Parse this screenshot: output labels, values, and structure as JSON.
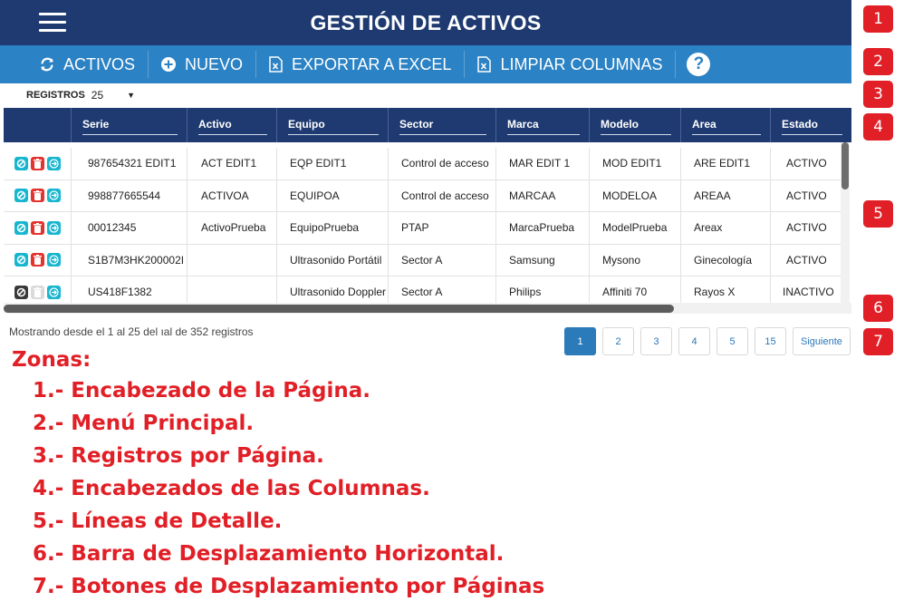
{
  "header": {
    "title": "GESTIÓN DE ACTIVOS"
  },
  "menu": {
    "items": [
      {
        "label": "ACTIVOS",
        "icon": "refresh-icon"
      },
      {
        "label": "NUEVO",
        "icon": "plus-circle-icon"
      },
      {
        "label": "EXPORTAR A EXCEL",
        "icon": "excel-icon"
      },
      {
        "label": "LIMPIAR COLUMNAS",
        "icon": "excel-icon"
      }
    ],
    "help": "?"
  },
  "registros": {
    "label": "REGISTROS",
    "value": "25"
  },
  "table": {
    "columns": [
      "Serie",
      "Activo",
      "Equipo",
      "Sector",
      "Marca",
      "Modelo",
      "Area",
      "Estado"
    ],
    "rows": [
      {
        "serie": "987654321 EDIT1",
        "activo": "ACT EDIT1",
        "equipo": "EQP EDIT1",
        "sector": "Control de acceso",
        "marca": "MAR EDIT 1",
        "modelo": "MOD EDIT1",
        "area": "ARE EDIT1",
        "estado": "ACTIVO"
      },
      {
        "serie": "998877665544",
        "activo": "ACTIVOA",
        "equipo": "EQUIPOA",
        "sector": "Control de acceso",
        "marca": "MARCAA",
        "modelo": "MODELOA",
        "area": "AREAA",
        "estado": "ACTIVO"
      },
      {
        "serie": "00012345",
        "activo": "ActivoPrueba",
        "equipo": "EquipoPrueba",
        "sector": "PTAP",
        "marca": "MarcaPrueba",
        "modelo": "ModelPrueba",
        "area": "Areax",
        "estado": "ACTIVO"
      },
      {
        "serie": "S1B7M3HK200002I",
        "activo": "",
        "equipo": "Ultrasonido Portátil",
        "sector": "Sector A",
        "marca": "Samsung",
        "modelo": "Mysono",
        "area": "Ginecología",
        "estado": "ACTIVO"
      },
      {
        "serie": "US418F1382",
        "activo": "",
        "equipo": "Ultrasonido Doppler",
        "sector": "Sector A",
        "marca": "Philips",
        "modelo": "Affiniti 70",
        "area": "Rayos X",
        "estado": "INACTIVO"
      }
    ]
  },
  "footer": {
    "text": "Mostrando desde el 1 al 25 del ıal de 352 registros"
  },
  "pagination": {
    "pages": [
      "1",
      "2",
      "3",
      "4",
      "5",
      "15"
    ],
    "active": "1",
    "next": "Siguiente"
  },
  "badges": [
    "1",
    "2",
    "3",
    "4",
    "5",
    "6",
    "7"
  ],
  "legend": {
    "title": "Zonas:",
    "items": [
      "1.- Encabezado de la Página.",
      "2.- Menú Principal.",
      "3.- Registros por Página.",
      "4.- Encabezados de las Columnas.",
      "5.- Líneas de Detalle.",
      "6.- Barra de Desplazamiento Horizontal.",
      "7.- Botones de Desplazamiento por Páginas"
    ]
  },
  "colors": {
    "header": "#1e3a70",
    "menu": "#2b82c4",
    "accent_red": "#e11f26",
    "action_cyan": "#17b6cf",
    "action_red": "#e2332e"
  }
}
